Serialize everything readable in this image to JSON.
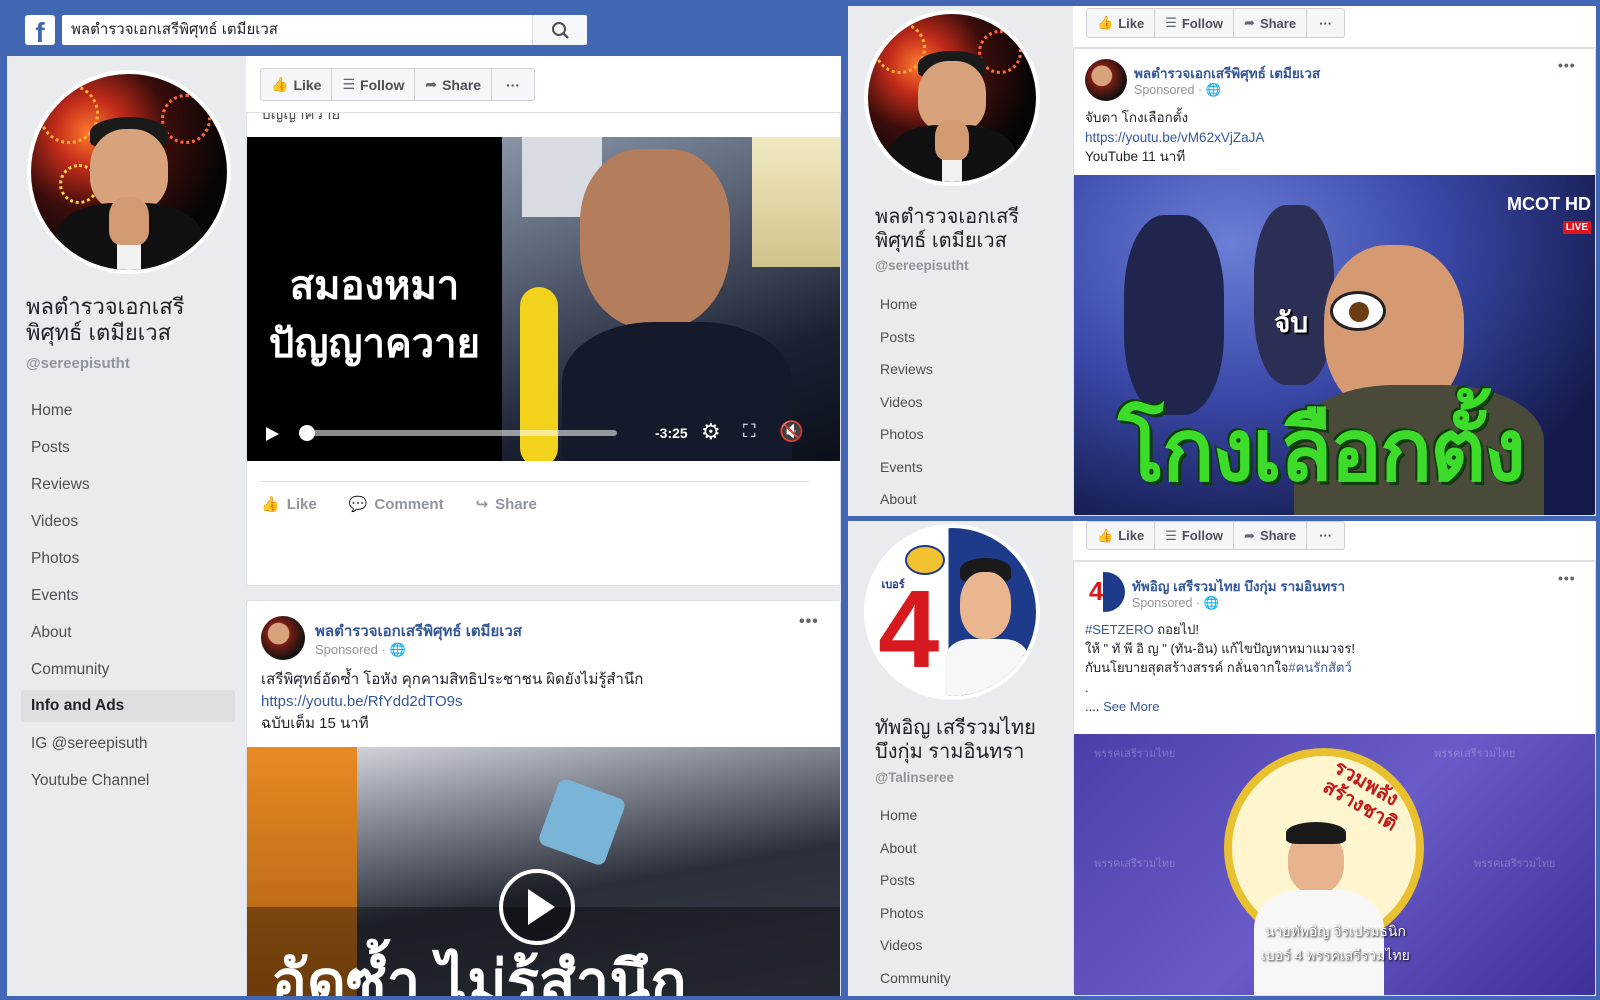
{
  "colors": {
    "fb_blue": "#4267b2",
    "link": "#365899",
    "bg": "#e9ebee",
    "accent_green": "#3ddc2b"
  },
  "search": {
    "value": "พลตำรวจเอกเสรีพิศุทธ์ เตมียเวส"
  },
  "panel1": {
    "page_name_line1": "พลตำรวจเอกเสรี",
    "page_name_line2": "พิศุทธ์ เตมียเวส",
    "handle": "@sereepisutht",
    "nav": [
      "Home",
      "Posts",
      "Reviews",
      "Videos",
      "Photos",
      "Events",
      "About",
      "Community",
      "Info and Ads",
      "IG @sereepisuth",
      "Youtube Channel"
    ],
    "nav_active": "Info and Ads",
    "toolbar": {
      "like": "Like",
      "follow": "Follow",
      "share": "Share",
      "more": "···"
    },
    "cut_text": "ปัญญาควาย",
    "video1": {
      "line1": "สมองหมา",
      "line2": "ปัญญาควาย",
      "time": "-3:25",
      "progress_pct": 2
    },
    "actions": {
      "like": "Like",
      "comment": "Comment",
      "share": "Share"
    },
    "post2": {
      "name": "พลตำรวจเอกเสรีพิศุทธ์ เตมียเวส",
      "sponsored": "Sponsored ·",
      "text1": "เสรีพิศุทธ์อัดซ้ำ โอหัง คุกคามสิทธิประชาชน ผิดยังไม่รู้สำนึก",
      "link": "https://youtu.be/RfYdd2dTO9s",
      "text3": "ฉบับเต็ม 15 นาที",
      "video_caption": "อัดซ้ำ ไม่รู้สำนึก"
    }
  },
  "panel2": {
    "page_name_line1": "พลตำรวจเอกเสรี",
    "page_name_line2": "พิศุทธ์ เตมียเวส",
    "handle": "@sereepisutht",
    "nav": [
      "Home",
      "Posts",
      "Reviews",
      "Videos",
      "Photos",
      "Events",
      "About"
    ],
    "toolbar": {
      "like": "Like",
      "follow": "Follow",
      "share": "Share",
      "more": "···"
    },
    "post": {
      "name": "พลตำรวจเอกเสรีพิศุทธ์ เตมียเวส",
      "sponsored": "Sponsored ·",
      "text1": "จับตา โกงเลือกตั้ง",
      "link": "https://youtu.be/vM62xVjZaJA",
      "text3": "YouTube 11 นาที",
      "video_small": "จับ",
      "video_big": "โกงเลือกตั้ง",
      "channel": "MCOT HD",
      "live": "LIVE"
    }
  },
  "panel3": {
    "page_name_line1": "ทัพอิญ เสรีรวมไทย",
    "page_name_line2": "บึงกุ่ม รามอินทรา",
    "handle": "@Talinseree",
    "nav": [
      "Home",
      "About",
      "Posts",
      "Photos",
      "Videos",
      "Community"
    ],
    "avatar_label": "เบอร์",
    "avatar_number": "4",
    "toolbar": {
      "like": "Like",
      "follow": "Follow",
      "share": "Share",
      "more": "···"
    },
    "post": {
      "name": "ทัพอิญ เสรีรวมไทย บึงกุ่ม รามอินทรา",
      "sponsored": "Sponsored ·",
      "line1_tag": "#SETZERO",
      "line1_rest": " ถอยไป!",
      "line2": "ให้ \" ทั พี อิ ญ \" (ทัน-อิน) แก้ไขปัญหาหมาแมวจร!",
      "line3_text": "กับนโยบายสุดสร้างสรรค์ กลั่นจากใจ",
      "line3_tag": "#คนรักสัตว์",
      "line4": ".",
      "line5_prefix": ".... ",
      "see_more": "See More",
      "watermark": "พรรคเสรีรวมไทย",
      "badge_text": "รวมพลัง สร้างชาติ",
      "caption1": "นายทัพอิญ จิรเปรมธนิก",
      "caption2": "เบอร์ 4 พรรคเสรีรวมไทย"
    }
  }
}
